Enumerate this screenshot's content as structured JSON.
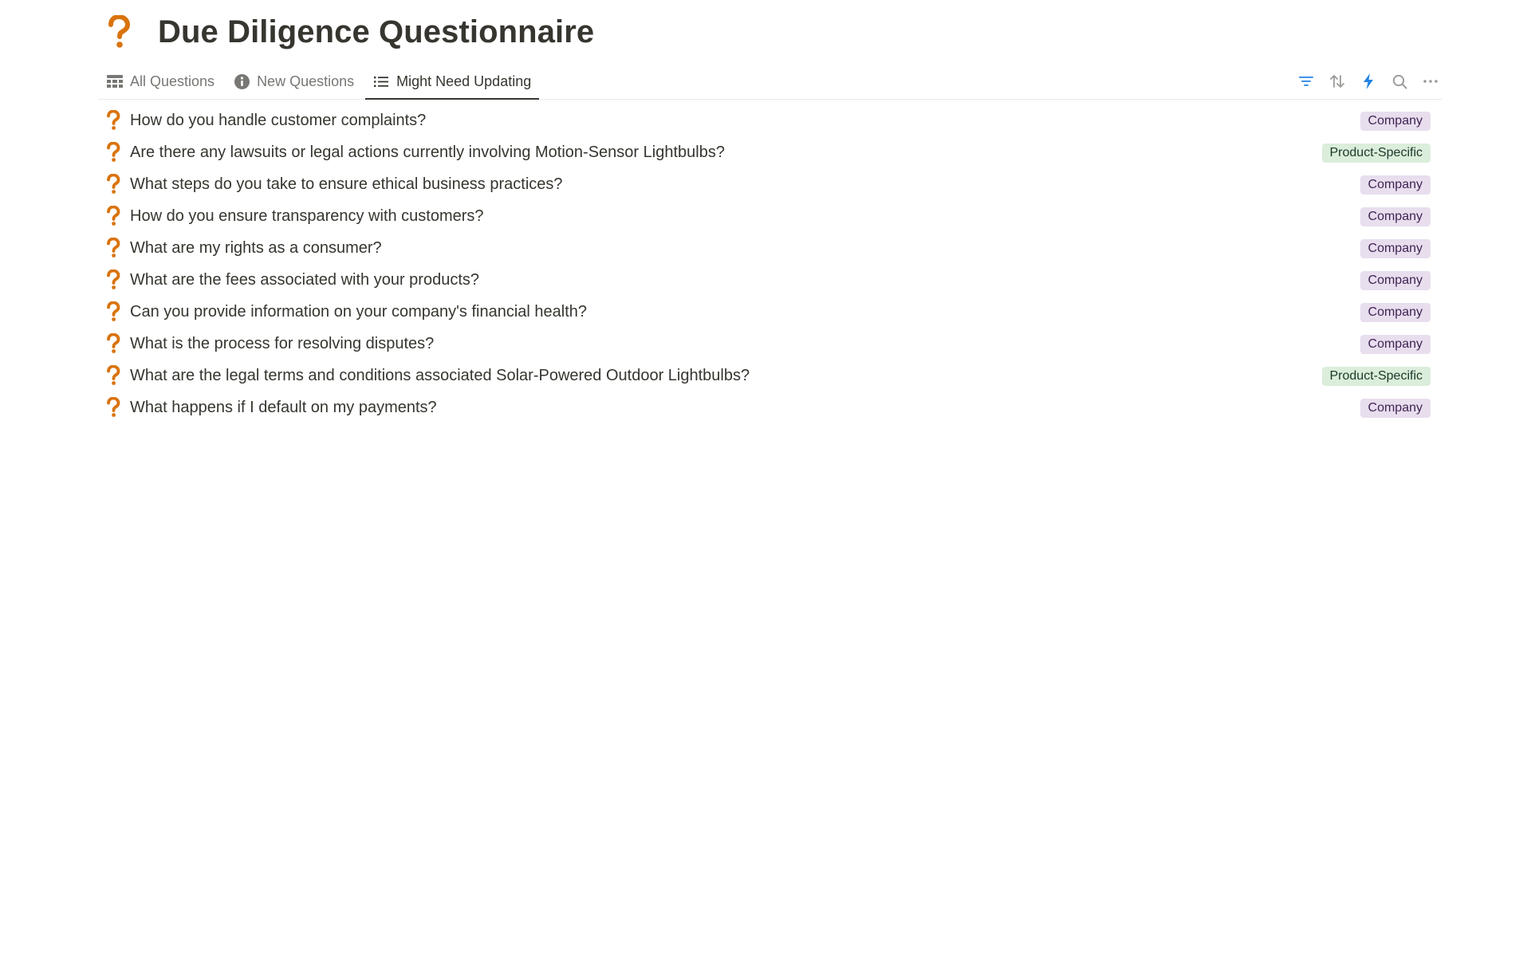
{
  "page": {
    "title": "Due Diligence Questionnaire",
    "icon": "question-mark-icon"
  },
  "tabs": [
    {
      "label": "All Questions",
      "icon": "table-icon",
      "active": false
    },
    {
      "label": "New Questions",
      "icon": "info-icon",
      "active": false
    },
    {
      "label": "Might Need Updating",
      "icon": "list-icon",
      "active": true
    }
  ],
  "toolbar": {
    "icons": [
      "filter-icon",
      "sort-icon",
      "automation-icon",
      "search-icon",
      "more-icon"
    ]
  },
  "questions": [
    {
      "text": "How do you handle customer complaints?",
      "tag": "Company"
    },
    {
      "text": "Are there any lawsuits or legal actions currently involving Motion-Sensor Lightbulbs?",
      "tag": "Product-Specific"
    },
    {
      "text": "What steps do you take to ensure ethical business practices?",
      "tag": "Company"
    },
    {
      "text": "How do you ensure transparency with customers?",
      "tag": "Company"
    },
    {
      "text": "What are my rights as a consumer?",
      "tag": "Company"
    },
    {
      "text": "What are the fees associated with your products?",
      "tag": "Company"
    },
    {
      "text": "Can you provide information on your company's financial health?",
      "tag": "Company"
    },
    {
      "text": "What is the process for resolving disputes?",
      "tag": "Company"
    },
    {
      "text": "What are the legal terms and conditions associated Solar-Powered Outdoor Lightbulbs?",
      "tag": "Product-Specific"
    },
    {
      "text": "What happens if I default on my payments?",
      "tag": "Company"
    }
  ],
  "colors": {
    "question_icon": "#d9730d",
    "accent_blue": "#2383e2",
    "company_tag_bg": "#e8deee",
    "product_tag_bg": "#dbeddb"
  }
}
